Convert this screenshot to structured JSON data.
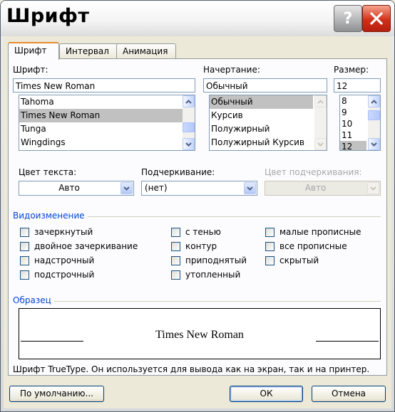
{
  "window": {
    "title": "Шрифт"
  },
  "tabs": [
    "Шрифт",
    "Интервал",
    "Анимация"
  ],
  "font": {
    "label": "Шрифт:",
    "value": "Times New Roman",
    "items": [
      "Tahoma",
      "Times New Roman",
      "Tunga",
      "Wingdings"
    ],
    "selected": "Times New Roman"
  },
  "style": {
    "label": "Начертание:",
    "value": "Обычный",
    "items": [
      "Обычный",
      "Курсив",
      "Полужирный",
      "Полужирный Курсив"
    ],
    "selected": "Обычный"
  },
  "size": {
    "label": "Размер:",
    "value": "12",
    "items": [
      "8",
      "9",
      "10",
      "11",
      "12"
    ],
    "selected": "12"
  },
  "text_color": {
    "label": "Цвет текста:",
    "value": "Авто"
  },
  "underline": {
    "label": "Подчеркивание:",
    "value": "(нет)"
  },
  "underline_color": {
    "label": "Цвет подчеркивания:",
    "value": "Авто"
  },
  "effects": {
    "title": "Видоизменение",
    "col1": [
      "зачеркнутый",
      "двойное зачеркивание",
      "надстрочный",
      "подстрочный"
    ],
    "col2": [
      "с тенью",
      "контур",
      "приподнятый",
      "утопленный"
    ],
    "col3": [
      "малые прописные",
      "все прописные",
      "скрытый"
    ]
  },
  "preview": {
    "title": "Образец",
    "text": "Times New Roman",
    "note": "Шрифт TrueType. Он используется для вывода как на экран, так и на принтер."
  },
  "buttons": {
    "default": "По умолчанию...",
    "ok": "ОК",
    "cancel": "Отмена"
  },
  "colors": {
    "accent_tab": "#e68b2c",
    "group_title": "#0046d5",
    "close_red": "#d1301a"
  }
}
